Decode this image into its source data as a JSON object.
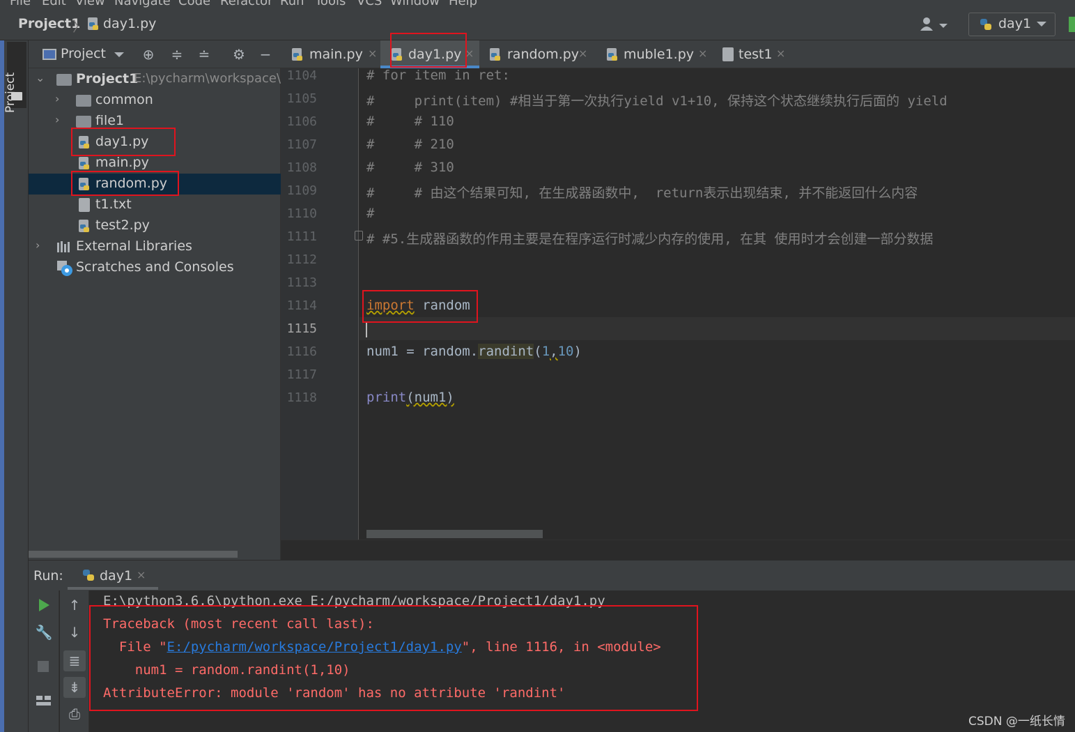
{
  "menu": [
    "File",
    "Edit",
    "View",
    "Navigate",
    "Code",
    "Refactor",
    "Run",
    "Tools",
    "VCS",
    "Window",
    "Help"
  ],
  "breadcrumb": {
    "project": "Project1",
    "file": "day1.py"
  },
  "run_config": {
    "label": "day1"
  },
  "left_strip": {
    "project_tab": "Project"
  },
  "project_panel": {
    "title": "Project",
    "tree": [
      {
        "label": "Project1",
        "extra": "E:\\pycharm\\workspace\\P",
        "type": "folder-root",
        "expanded": true
      },
      {
        "label": "common",
        "type": "folder",
        "expanded": false
      },
      {
        "label": "file1",
        "type": "folder",
        "expanded": false
      },
      {
        "label": "day1.py",
        "type": "python"
      },
      {
        "label": "main.py",
        "type": "python"
      },
      {
        "label": "random.py",
        "type": "python",
        "selected": true
      },
      {
        "label": "t1.txt",
        "type": "text"
      },
      {
        "label": "test2.py",
        "type": "python"
      },
      {
        "label": "External Libraries",
        "type": "library",
        "expanded": false
      },
      {
        "label": "Scratches and Consoles",
        "type": "scratches"
      }
    ]
  },
  "tabs": [
    {
      "label": "main.py",
      "close": "×"
    },
    {
      "label": "day1.py",
      "close": "×",
      "active": true
    },
    {
      "label": "random.py",
      "close": "×"
    },
    {
      "label": "muble1.py",
      "close": "×"
    },
    {
      "label": "test1",
      "close": "×"
    }
  ],
  "editor": {
    "line_numbers": [
      "1104",
      "1105",
      "1106",
      "1107",
      "1108",
      "1109",
      "1110",
      "1111",
      "1112",
      "1113",
      "1114",
      "1115",
      "1116",
      "1117",
      "1118"
    ],
    "current_line": "1115",
    "comments": [
      "# for item in ret:",
      "#     print(item) #相当于第一次执行yield v1+10, 保持这个状态继续执行后面的 yield",
      "#     # 110",
      "#     # 210",
      "#     # 310",
      "#     # 由这个结果可知, 在生成器函数中,  return表示出现结束, 并不能返回什么内容",
      "#",
      "# #5.生成器函数的作用主要是在程序运行时减少内存的使用, 在其 使用时才会创建一部分数据"
    ],
    "import_kw": "import",
    "import_mod": " random",
    "l1116_a": "num1 = random.",
    "l1116_fn": "randint",
    "l1116_p1": "(",
    "l1116_n1": "1",
    "l1116_comma": ",",
    "l1116_n2": "10",
    "l1116_p2": ")",
    "l1118_fn": "print",
    "l1118_rest": "(num1)"
  },
  "run_panel": {
    "label": "Run:",
    "tab": "day1",
    "tab_close": "×",
    "console": {
      "cmd": "E:\\python3.6.6\\python.exe E:/pycharm/workspace/Project1/day1.py",
      "tb1": "Traceback (most recent call last):",
      "file_pre": "  File \"",
      "file_link": "E:/pycharm/workspace/Project1/day1.py",
      "file_post": "\", line 1116, in <module>",
      "code_line": "    num1 = random.randint(1,10)",
      "error": "AttributeError: module 'random' has no attribute 'randint'"
    }
  },
  "watermark": "CSDN @一纸长情",
  "colors": {
    "accent": "#4a88c7",
    "annotation_red": "#e0141e",
    "error_text": "#ff6b68",
    "link": "#287bde"
  }
}
